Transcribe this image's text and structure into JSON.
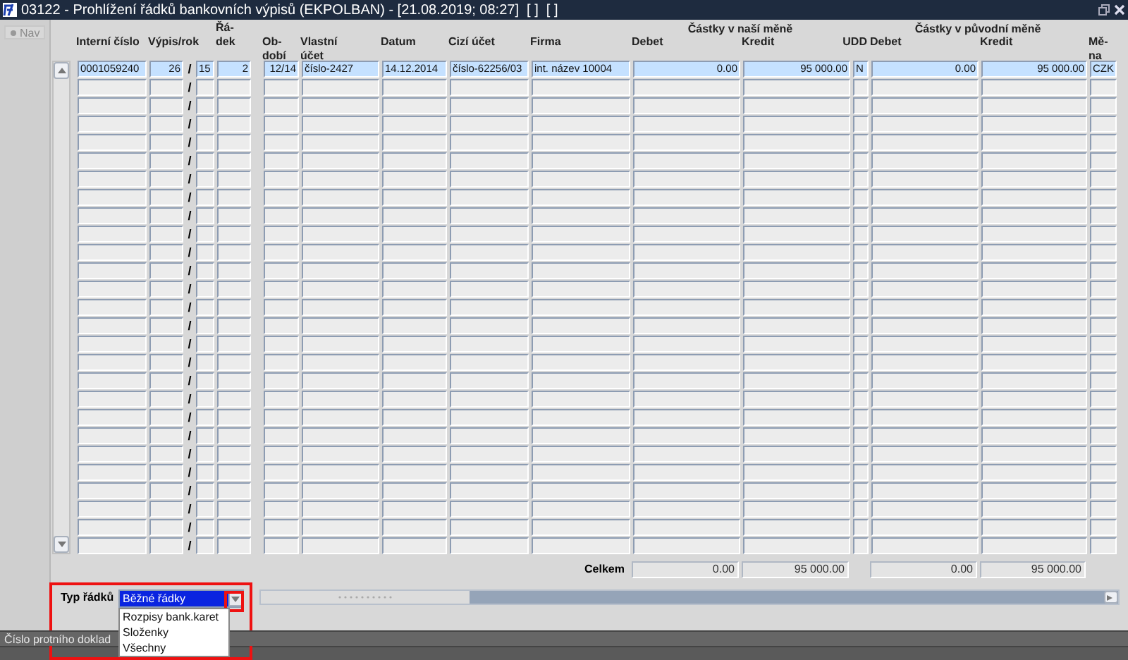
{
  "window": {
    "title": "03122 - Prohlížení řádků bankovních výpisů (EKPOLBAN) - [21.08.2019; 08:27]  [ ]  [ ]"
  },
  "sidebar": {
    "nav_button": "Nav"
  },
  "table": {
    "groups": [
      "Částky v naší měně",
      "Částky v původní měně"
    ],
    "columns": [
      {
        "label": "Interní číslo"
      },
      {
        "label": "Výpis/rok"
      },
      {
        "label": "Řá-\ndek"
      },
      {
        "label": "Ob-\ndobí"
      },
      {
        "label": "Vlastní\núčet"
      },
      {
        "label": "Datum"
      },
      {
        "label": "Cizí účet"
      },
      {
        "label": "Firma"
      },
      {
        "label": "Debet"
      },
      {
        "label": "Kredit"
      },
      {
        "label": "UDD"
      },
      {
        "label": "Debet"
      },
      {
        "label": "Kredit"
      },
      {
        "label": "Mě-\nna"
      }
    ],
    "rows": [
      {
        "selected": true,
        "interni_cislo": "0001059240",
        "vypis": "26",
        "separator": "/",
        "rok": "15",
        "radek": "2",
        "obdobi": "12/14",
        "vlastni_ucet": "číslo-2427",
        "datum": "14.12.2014",
        "cizi_ucet": "číslo-62256/03",
        "firma": "int. název 10004",
        "debet": "0.00",
        "kredit": "95 000.00",
        "udd": "N",
        "debet_puvodni": "0.00",
        "kredit_puvodni": "95 000.00",
        "mena": "CZK"
      },
      {
        "selected": false,
        "separator": "/"
      },
      {
        "selected": false,
        "separator": "/"
      },
      {
        "selected": false,
        "separator": "/"
      },
      {
        "selected": false,
        "separator": "/"
      },
      {
        "selected": false,
        "separator": "/"
      },
      {
        "selected": false,
        "separator": "/"
      },
      {
        "selected": false,
        "separator": "/"
      },
      {
        "selected": false,
        "separator": "/"
      },
      {
        "selected": false,
        "separator": "/"
      },
      {
        "selected": false,
        "separator": "/"
      },
      {
        "selected": false,
        "separator": "/"
      },
      {
        "selected": false,
        "separator": "/"
      },
      {
        "selected": false,
        "separator": "/"
      },
      {
        "selected": false,
        "separator": "/"
      },
      {
        "selected": false,
        "separator": "/"
      },
      {
        "selected": false,
        "separator": "/"
      },
      {
        "selected": false,
        "separator": "/"
      },
      {
        "selected": false,
        "separator": "/"
      },
      {
        "selected": false,
        "separator": "/"
      },
      {
        "selected": false,
        "separator": "/"
      },
      {
        "selected": false,
        "separator": "/"
      },
      {
        "selected": false,
        "separator": "/"
      },
      {
        "selected": false,
        "separator": "/"
      },
      {
        "selected": false,
        "separator": "/"
      },
      {
        "selected": false,
        "separator": "/"
      },
      {
        "selected": false,
        "separator": "/"
      }
    ],
    "totals": {
      "label": "Celkem",
      "debet": "0.00",
      "kredit": "95 000.00",
      "debet_puvodni": "0.00",
      "kredit_puvodni": "95 000.00"
    }
  },
  "row_type": {
    "label": "Typ řádků",
    "value": "Běžné řádky",
    "expanded": true,
    "options": [
      {
        "label": "Rozpisy bank.karet"
      },
      {
        "label": "Složenky"
      },
      {
        "label": "Všechny"
      }
    ]
  },
  "status_bar": {
    "text": "Číslo protního doklad"
  }
}
